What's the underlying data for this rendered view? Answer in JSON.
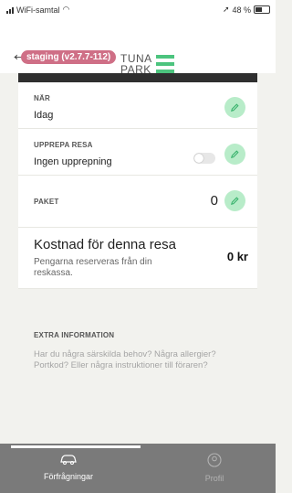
{
  "status": {
    "carrier": "WiFi-samtal",
    "battery": "48 %"
  },
  "header": {
    "staging_badge": "staging (v2.7.7-112)",
    "logo_line1": "TUNA",
    "logo_line2": "PARK"
  },
  "fields": {
    "nar": {
      "label": "NÄR",
      "value": "Idag"
    },
    "upprepa": {
      "label": "UPPREPA RESA",
      "value": "Ingen upprepning"
    },
    "paket": {
      "label": "PAKET",
      "value": "0"
    }
  },
  "cost": {
    "title": "Kostnad för denna resa",
    "desc": "Pengarna reserveras från din reskassa.",
    "price": "0 kr"
  },
  "extra": {
    "label": "EXTRA INFORMATION",
    "hint": "Har du några särskilda behov? Några allergier? Portkod? Eller några instruktioner till föraren?"
  },
  "tabs": {
    "requests": "Förfrågningar",
    "profile": "Profil"
  },
  "colors": {
    "accent": "#b8ecc9",
    "staging": "#cf6f86",
    "tabbar": "#7a7a7a"
  }
}
